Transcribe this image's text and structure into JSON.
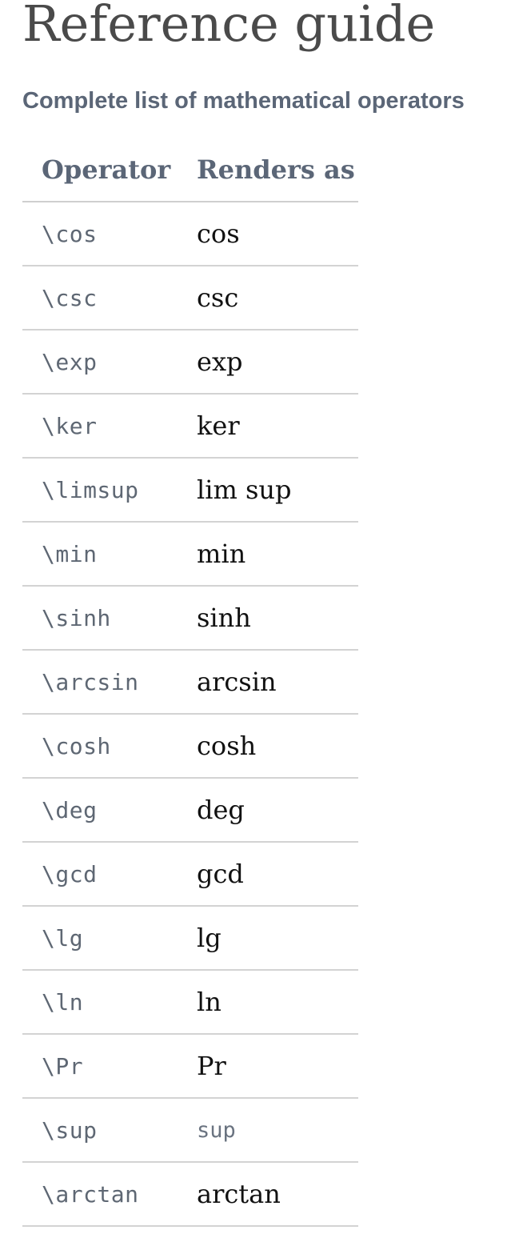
{
  "page": {
    "title": "Reference guide",
    "subtitle": "Complete list of mathematical operators"
  },
  "table": {
    "headers": {
      "operator": "Operator",
      "renders_as": "Renders as"
    },
    "rows": [
      {
        "operator": "\\cos",
        "renders_as": "cos",
        "render_style": "math"
      },
      {
        "operator": "\\csc",
        "renders_as": "csc",
        "render_style": "math"
      },
      {
        "operator": "\\exp",
        "renders_as": "exp",
        "render_style": "math"
      },
      {
        "operator": "\\ker",
        "renders_as": "ker",
        "render_style": "math"
      },
      {
        "operator": "\\limsup",
        "renders_as": "lim sup",
        "render_style": "math"
      },
      {
        "operator": "\\min",
        "renders_as": "min",
        "render_style": "math"
      },
      {
        "operator": "\\sinh",
        "renders_as": "sinh",
        "render_style": "math"
      },
      {
        "operator": "\\arcsin",
        "renders_as": "arcsin",
        "render_style": "math"
      },
      {
        "operator": "\\cosh",
        "renders_as": "cosh",
        "render_style": "math"
      },
      {
        "operator": "\\deg",
        "renders_as": "deg",
        "render_style": "math"
      },
      {
        "operator": "\\gcd",
        "renders_as": "gcd",
        "render_style": "math"
      },
      {
        "operator": "\\lg",
        "renders_as": "lg",
        "render_style": "math"
      },
      {
        "operator": "\\ln",
        "renders_as": "ln",
        "render_style": "math"
      },
      {
        "operator": "\\Pr",
        "renders_as": "Pr",
        "render_style": "math"
      },
      {
        "operator": "\\sup",
        "renders_as": "sup",
        "render_style": "mono"
      },
      {
        "operator": "\\arctan",
        "renders_as": "arctan",
        "render_style": "math"
      }
    ]
  },
  "colors": {
    "title": "#4a4a4a",
    "subtitle": "#5b6677",
    "code": "#5e6773",
    "rendered": "#111111",
    "rule": "#d3d3d3"
  }
}
